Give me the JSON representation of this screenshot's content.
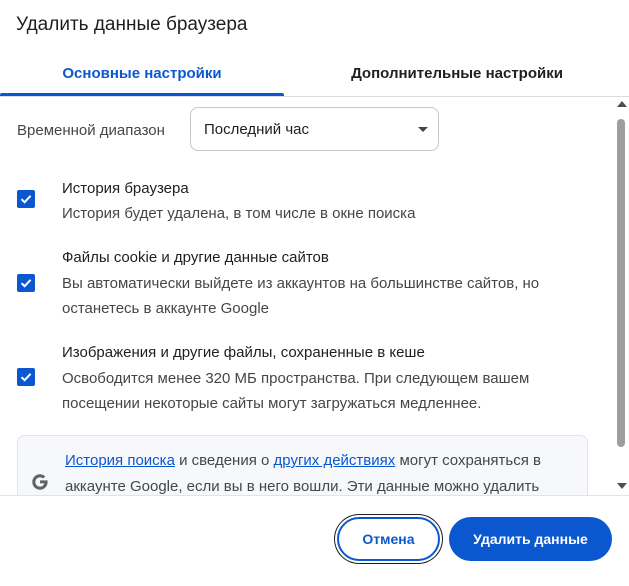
{
  "dialog": {
    "title": "Удалить данные браузера"
  },
  "tabs": [
    {
      "label": "Основные настройки",
      "active": true
    },
    {
      "label": "Дополнительные настройки",
      "active": false
    }
  ],
  "time_range": {
    "label": "Временной диапазон",
    "selected": "Последний час"
  },
  "checkboxes": [
    {
      "title": "История браузера",
      "description": "История будет удалена, в том числе в окне поиска",
      "checked": true
    },
    {
      "title": "Файлы cookie и другие данные сайтов",
      "description": "Вы автоматически выйдете из аккаунтов на большинстве сайтов, но останетесь в аккаунте Google",
      "checked": true
    },
    {
      "title": "Изображения и другие файлы, сохраненные в кеше",
      "description": "Освободится менее 320 МБ пространства. При следующем вашем посещении некоторые сайты могут загружаться медленнее.",
      "checked": true
    }
  ],
  "google_notice": {
    "link1": "История поиска",
    "text1": " и сведения о ",
    "link2": "других действиях",
    "text2": " могут сохраняться в аккаунте Google, если вы в него вошли. Эти данные можно удалить"
  },
  "buttons": {
    "cancel": "Отмена",
    "delete": "Удалить данные"
  },
  "colors": {
    "accent": "#0b57d0",
    "text": "#1f1f1f",
    "secondary_text": "#444746"
  },
  "icons": {
    "checkbox": "check-icon",
    "dropdown": "caret-down-icon",
    "google": "google-g-icon"
  }
}
